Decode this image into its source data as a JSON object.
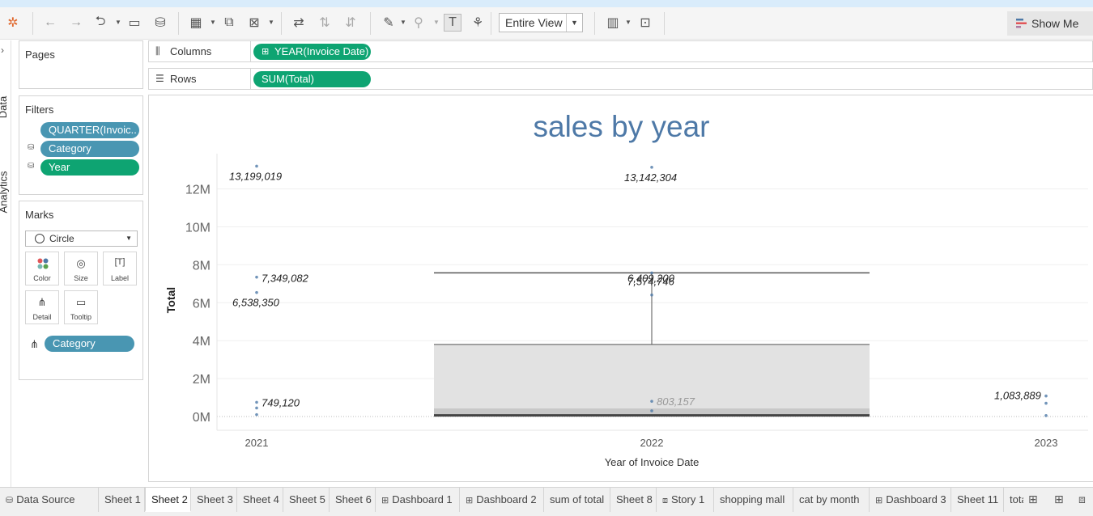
{
  "toolbar": {
    "view_select": "Entire View",
    "show_me_label": "Show Me"
  },
  "side_tabs": {
    "data": "Data",
    "analytics": "Analytics"
  },
  "pages": {
    "title": "Pages"
  },
  "filters": {
    "title": "Filters",
    "items": [
      {
        "label": "QUARTER(Invoic..",
        "color": "#4996b2"
      },
      {
        "label": "Category",
        "color": "#4996b2"
      },
      {
        "label": "Year",
        "color": "#0ea472"
      }
    ]
  },
  "marks": {
    "title": "Marks",
    "mark_type": "Circle",
    "buttons": [
      "Color",
      "Size",
      "Label",
      "Detail",
      "Tooltip"
    ],
    "detail_field": "Category"
  },
  "shelves": {
    "columns_label": "Columns",
    "columns_pill": "YEAR(Invoice Date)",
    "rows_label": "Rows",
    "rows_pill": "SUM(Total)"
  },
  "chart_data": {
    "type": "scatter",
    "title": "sales by year",
    "xlabel": "Year of Invoice Date",
    "ylabel": "Total",
    "categories": [
      "2021",
      "2022",
      "2023"
    ],
    "y_ticks": [
      "0M",
      "2M",
      "4M",
      "6M",
      "8M",
      "10M",
      "12M"
    ],
    "ylim": [
      -1000000,
      14000000
    ],
    "points": [
      {
        "x": "2021",
        "y": 13199019,
        "label": "13,199,019"
      },
      {
        "x": "2021",
        "y": 7349082,
        "label": "7,349,082"
      },
      {
        "x": "2021",
        "y": 6538350,
        "label": "6,538,350"
      },
      {
        "x": "2021",
        "y": 749120,
        "label": "749,120"
      },
      {
        "x": "2021",
        "y": 450000,
        "label": ""
      },
      {
        "x": "2021",
        "y": 100000,
        "label": ""
      },
      {
        "x": "2022",
        "y": 13142304,
        "label": "13,142,304"
      },
      {
        "x": "2022",
        "y": 7574746,
        "label": "7,574,746"
      },
      {
        "x": "2022",
        "y": 6409200,
        "label": "6,409,200"
      },
      {
        "x": "2022",
        "y": 803157,
        "label": "803,157"
      },
      {
        "x": "2022",
        "y": 300000,
        "label": ""
      },
      {
        "x": "2023",
        "y": 1083889,
        "label": "1,083,889"
      },
      {
        "x": "2023",
        "y": 700000,
        "label": ""
      },
      {
        "x": "2023",
        "y": 50000,
        "label": ""
      }
    ],
    "box_2022": {
      "upper_whisker": 7574746,
      "upper_hinge": 3800000,
      "median": 430000,
      "lower_hinge": 60000,
      "lower_whisker": 0
    },
    "colors": {
      "title": "#4e79a7",
      "point": "#4e79a7",
      "box_upper": "#e2e2e2",
      "box_lower": "#c8c8c8"
    }
  },
  "sheet_tabs": [
    {
      "label": "Data Source",
      "icon": "datasource-icon"
    },
    {
      "label": "Sheet 1"
    },
    {
      "label": "Sheet 2",
      "active": true
    },
    {
      "label": "Sheet 3"
    },
    {
      "label": "Sheet 4"
    },
    {
      "label": "Sheet 5"
    },
    {
      "label": "Sheet 6"
    },
    {
      "label": "Dashboard 1",
      "icon": "dashboard-icon"
    },
    {
      "label": "Dashboard 2",
      "icon": "dashboard-icon"
    },
    {
      "label": "sum of total"
    },
    {
      "label": "Sheet 8"
    },
    {
      "label": "Story 1",
      "icon": "story-icon"
    },
    {
      "label": "shopping mall"
    },
    {
      "label": "cat by month"
    },
    {
      "label": "Dashboard 3",
      "icon": "dashboard-icon"
    },
    {
      "label": "Sheet 11"
    },
    {
      "label": "tota"
    }
  ]
}
